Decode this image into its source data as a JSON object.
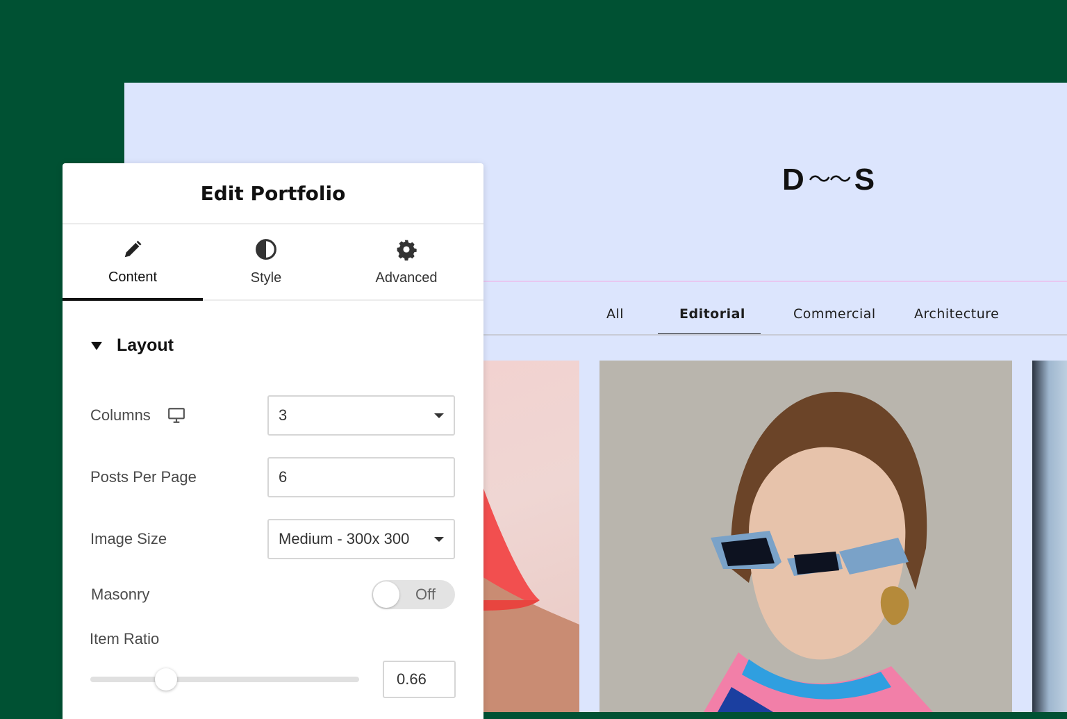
{
  "preview": {
    "logo_left": "D",
    "logo_wave": "〜〜",
    "logo_right": "S",
    "filters": [
      {
        "label": "All",
        "active": false
      },
      {
        "label": "Editorial",
        "active": true
      },
      {
        "label": "Commercial",
        "active": false
      },
      {
        "label": "Architecture",
        "active": false
      }
    ]
  },
  "panel": {
    "title": "Edit Portfolio",
    "tabs": [
      {
        "label": "Content",
        "icon": "pencil-icon",
        "active": true
      },
      {
        "label": "Style",
        "icon": "contrast-icon",
        "active": false
      },
      {
        "label": "Advanced",
        "icon": "gear-icon",
        "active": false
      }
    ],
    "section_title": "Layout",
    "columns": {
      "label": "Columns",
      "value": "3",
      "icon": "desktop-icon"
    },
    "posts_per_page": {
      "label": "Posts Per Page",
      "value": "6"
    },
    "image_size": {
      "label": "Image Size",
      "value": "Medium - 300x 300"
    },
    "masonry": {
      "label": "Masonry",
      "state": "Off"
    },
    "item_ratio": {
      "label": "Item Ratio",
      "value": "0.66",
      "slider_fraction": 0.29
    }
  },
  "colors": {
    "outer_background": "#005133",
    "preview_background": "#dce5fd",
    "panel_background": "#ffffff"
  }
}
